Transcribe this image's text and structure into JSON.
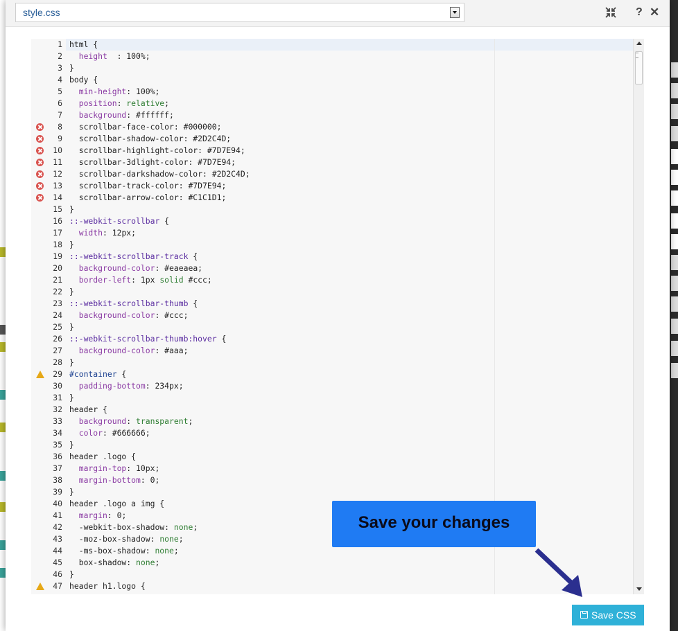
{
  "file_select": {
    "value": "style.css"
  },
  "toolbar": {
    "help_label": "?",
    "close_label": "✕"
  },
  "editor": {
    "lines": [
      {
        "n": "1",
        "mark": "",
        "parts": [
          [
            "sel",
            "html {"
          ]
        ]
      },
      {
        "n": "2",
        "mark": "",
        "parts": [
          [
            "prop",
            "  height"
          ],
          [
            "",
            "  : 100%;"
          ]
        ]
      },
      {
        "n": "3",
        "mark": "",
        "parts": [
          [
            "sel",
            "}"
          ]
        ]
      },
      {
        "n": "4",
        "mark": "",
        "parts": [
          [
            "sel",
            "body {"
          ]
        ]
      },
      {
        "n": "5",
        "mark": "",
        "parts": [
          [
            "prop",
            "  min-height"
          ],
          [
            "",
            ": 100%;"
          ]
        ]
      },
      {
        "n": "6",
        "mark": "",
        "parts": [
          [
            "prop",
            "  position"
          ],
          [
            "",
            ": "
          ],
          [
            "val",
            "relative"
          ],
          [
            "",
            ";"
          ]
        ]
      },
      {
        "n": "7",
        "mark": "",
        "parts": [
          [
            "prop",
            "  background"
          ],
          [
            "",
            ": #ffffff;"
          ]
        ]
      },
      {
        "n": "8",
        "mark": "error",
        "parts": [
          [
            "",
            "  scrollbar-face-color: #000000;"
          ]
        ]
      },
      {
        "n": "9",
        "mark": "error",
        "parts": [
          [
            "",
            "  scrollbar-shadow-color: #2D2C4D;"
          ]
        ]
      },
      {
        "n": "10",
        "mark": "error",
        "parts": [
          [
            "",
            "  scrollbar-highlight-color: #7D7E94;"
          ]
        ]
      },
      {
        "n": "11",
        "mark": "error",
        "parts": [
          [
            "",
            "  scrollbar-3dlight-color: #7D7E94;"
          ]
        ]
      },
      {
        "n": "12",
        "mark": "error",
        "parts": [
          [
            "",
            "  scrollbar-darkshadow-color: #2D2C4D;"
          ]
        ]
      },
      {
        "n": "13",
        "mark": "error",
        "parts": [
          [
            "",
            "  scrollbar-track-color: #7D7E94;"
          ]
        ]
      },
      {
        "n": "14",
        "mark": "error",
        "parts": [
          [
            "",
            "  scrollbar-arrow-color: #C1C1D1;"
          ]
        ]
      },
      {
        "n": "15",
        "mark": "",
        "parts": [
          [
            "sel",
            "}"
          ]
        ]
      },
      {
        "n": "16",
        "mark": "",
        "parts": [
          [
            "pseudo",
            "::-webkit-scrollbar"
          ],
          [
            "sel",
            " {"
          ]
        ]
      },
      {
        "n": "17",
        "mark": "",
        "parts": [
          [
            "prop",
            "  width"
          ],
          [
            "",
            ": 12px;"
          ]
        ]
      },
      {
        "n": "18",
        "mark": "",
        "parts": [
          [
            "sel",
            "}"
          ]
        ]
      },
      {
        "n": "19",
        "mark": "",
        "parts": [
          [
            "pseudo",
            "::-webkit-scrollbar-track"
          ],
          [
            "sel",
            " {"
          ]
        ]
      },
      {
        "n": "20",
        "mark": "",
        "parts": [
          [
            "prop",
            "  background-color"
          ],
          [
            "",
            ": #eaeaea;"
          ]
        ]
      },
      {
        "n": "21",
        "mark": "",
        "parts": [
          [
            "prop",
            "  border-left"
          ],
          [
            "",
            ": 1px "
          ],
          [
            "val",
            "solid"
          ],
          [
            "",
            " #ccc;"
          ]
        ]
      },
      {
        "n": "22",
        "mark": "",
        "parts": [
          [
            "sel",
            "}"
          ]
        ]
      },
      {
        "n": "23",
        "mark": "",
        "parts": [
          [
            "pseudo",
            "::-webkit-scrollbar-thumb"
          ],
          [
            "sel",
            " {"
          ]
        ]
      },
      {
        "n": "24",
        "mark": "",
        "parts": [
          [
            "prop",
            "  background-color"
          ],
          [
            "",
            ": #ccc;"
          ]
        ]
      },
      {
        "n": "25",
        "mark": "",
        "parts": [
          [
            "sel",
            "}"
          ]
        ]
      },
      {
        "n": "26",
        "mark": "",
        "parts": [
          [
            "pseudo",
            "::-webkit-scrollbar-thumb:hover"
          ],
          [
            "sel",
            " {"
          ]
        ]
      },
      {
        "n": "27",
        "mark": "",
        "parts": [
          [
            "prop",
            "  background-color"
          ],
          [
            "",
            ": #aaa;"
          ]
        ]
      },
      {
        "n": "28",
        "mark": "",
        "parts": [
          [
            "sel",
            "}"
          ]
        ]
      },
      {
        "n": "29",
        "mark": "warning",
        "parts": [
          [
            "id",
            "#container"
          ],
          [
            "sel",
            " {"
          ]
        ]
      },
      {
        "n": "30",
        "mark": "",
        "parts": [
          [
            "prop",
            "  padding-bottom"
          ],
          [
            "",
            ": 234px;"
          ]
        ]
      },
      {
        "n": "31",
        "mark": "",
        "parts": [
          [
            "sel",
            "}"
          ]
        ]
      },
      {
        "n": "32",
        "mark": "",
        "parts": [
          [
            "sel",
            "header {"
          ]
        ]
      },
      {
        "n": "33",
        "mark": "",
        "parts": [
          [
            "prop",
            "  background"
          ],
          [
            "",
            ": "
          ],
          [
            "val",
            "transparent"
          ],
          [
            "",
            ";"
          ]
        ]
      },
      {
        "n": "34",
        "mark": "",
        "parts": [
          [
            "prop",
            "  color"
          ],
          [
            "",
            ": #666666;"
          ]
        ]
      },
      {
        "n": "35",
        "mark": "",
        "parts": [
          [
            "sel",
            "}"
          ]
        ]
      },
      {
        "n": "36",
        "mark": "",
        "parts": [
          [
            "sel",
            "header .logo {"
          ]
        ]
      },
      {
        "n": "37",
        "mark": "",
        "parts": [
          [
            "prop",
            "  margin-top"
          ],
          [
            "",
            ": 10px;"
          ]
        ]
      },
      {
        "n": "38",
        "mark": "",
        "parts": [
          [
            "prop",
            "  margin-bottom"
          ],
          [
            "",
            ": 0;"
          ]
        ]
      },
      {
        "n": "39",
        "mark": "",
        "parts": [
          [
            "sel",
            "}"
          ]
        ]
      },
      {
        "n": "40",
        "mark": "",
        "parts": [
          [
            "sel",
            "header .logo a img {"
          ]
        ]
      },
      {
        "n": "41",
        "mark": "",
        "parts": [
          [
            "prop",
            "  margin"
          ],
          [
            "",
            ": 0;"
          ]
        ]
      },
      {
        "n": "42",
        "mark": "",
        "parts": [
          [
            "",
            "  -webkit-box-shadow: "
          ],
          [
            "val",
            "none"
          ],
          [
            "",
            ";"
          ]
        ]
      },
      {
        "n": "43",
        "mark": "",
        "parts": [
          [
            "",
            "  -moz-box-shadow: "
          ],
          [
            "val",
            "none"
          ],
          [
            "",
            ";"
          ]
        ]
      },
      {
        "n": "44",
        "mark": "",
        "parts": [
          [
            "",
            "  -ms-box-shadow: "
          ],
          [
            "val",
            "none"
          ],
          [
            "",
            ";"
          ]
        ]
      },
      {
        "n": "45",
        "mark": "",
        "parts": [
          [
            "",
            "  box-shadow: "
          ],
          [
            "val",
            "none"
          ],
          [
            "",
            ";"
          ]
        ]
      },
      {
        "n": "46",
        "mark": "",
        "parts": [
          [
            "sel",
            "}"
          ]
        ]
      },
      {
        "n": "47",
        "mark": "warning",
        "parts": [
          [
            "sel",
            "header h1.logo {"
          ]
        ]
      }
    ]
  },
  "callout": {
    "text": "Save your changes"
  },
  "save_button": {
    "label": "Save CSS"
  },
  "colors": {
    "save_button": "#2fb1d8",
    "callout": "#1f7bf3",
    "arrow": "#2b2f8f",
    "error": "#d9534f",
    "warning": "#e6a817"
  }
}
